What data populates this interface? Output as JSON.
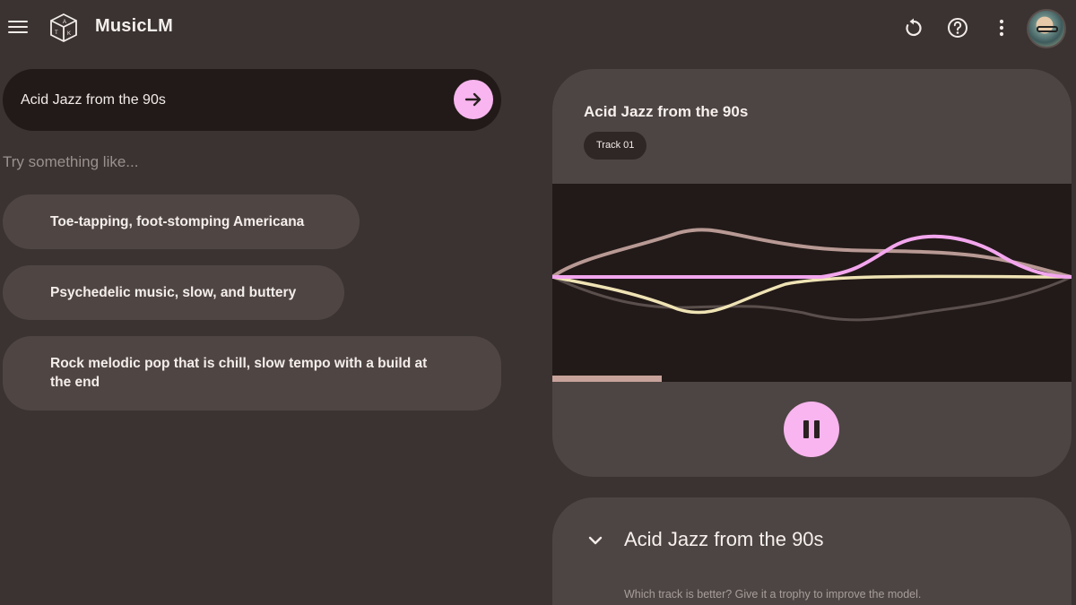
{
  "header": {
    "title": "MusicLM",
    "menu_icon": "hamburger-menu-icon",
    "logo_icon": "aitk-cube-logo-icon",
    "actions": [
      "reset-icon",
      "help-icon",
      "more-vert-icon"
    ],
    "avatar": "user-avatar"
  },
  "search": {
    "value": "Acid Jazz from the 90s",
    "submit_icon": "arrow-right-icon"
  },
  "suggestions": {
    "label": "Try something like...",
    "items": [
      "Toe-tapping, foot-stomping Americana",
      "Psychedelic music, slow, and buttery",
      "Rock melodic pop that is chill, slow tempo with a build at the end"
    ]
  },
  "track": {
    "title": "Acid Jazz from the 90s",
    "chip": "Track 01",
    "progress": 0.21,
    "control_icon": "pause-icon"
  },
  "result": {
    "title": "Acid Jazz from the 90s",
    "hint": "Which track is better? Give it a trophy to improve the model.",
    "expand_icon": "chevron-down-icon"
  },
  "colors": {
    "background": "#3a3331",
    "card": "#4d4543",
    "dark": "#221a18",
    "accent_pink": "#f8b5ef",
    "wave_mauve": "#c7a29b",
    "wave_cream": "#efe3b5",
    "wave_pink": "#f3a6ee"
  }
}
